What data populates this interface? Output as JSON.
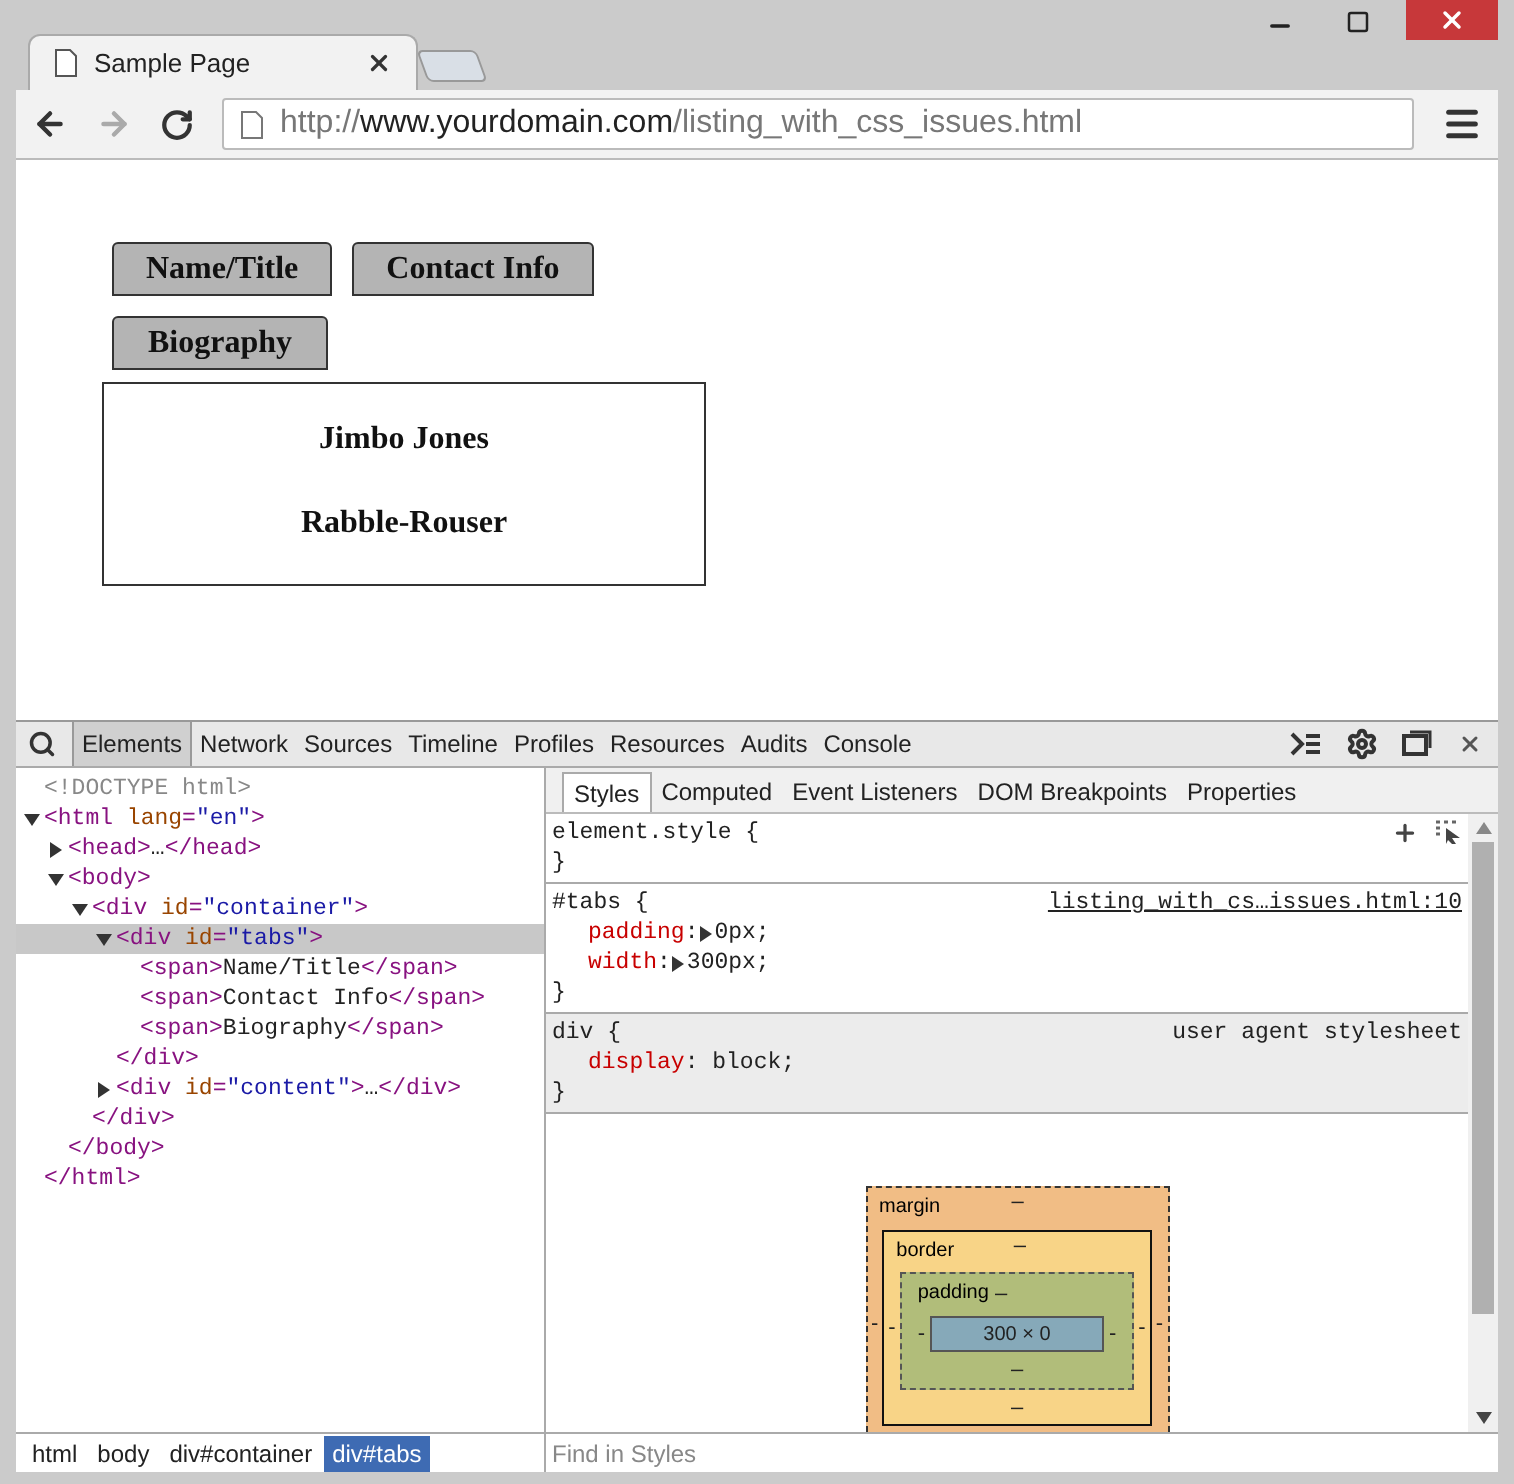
{
  "browser_tab": {
    "title": "Sample Page"
  },
  "address_bar": {
    "scheme": "http://",
    "host": "www.yourdomain.com",
    "path": "/listing_with_css_issues.html"
  },
  "page": {
    "tabs": [
      {
        "label": "Name/Title"
      },
      {
        "label": "Contact Info"
      },
      {
        "label": "Biography"
      }
    ],
    "content": [
      "Jimbo Jones",
      "Rabble-Rouser"
    ]
  },
  "devtools": {
    "panels": [
      {
        "label": "Elements",
        "selected": true
      },
      {
        "label": "Network",
        "selected": false
      },
      {
        "label": "Sources",
        "selected": false
      },
      {
        "label": "Timeline",
        "selected": false
      },
      {
        "label": "Profiles",
        "selected": false
      },
      {
        "label": "Resources",
        "selected": false
      },
      {
        "label": "Audits",
        "selected": false
      },
      {
        "label": "Console",
        "selected": false
      }
    ],
    "dom_tree": [
      {
        "tokens": [
          {
            "kind": "doctype",
            "text": "<!DOCTYPE html>"
          }
        ],
        "selected": false
      },
      {
        "tokens": [
          {
            "kind": "tag",
            "text": "<html "
          },
          {
            "kind": "attr",
            "text": "lang"
          },
          {
            "kind": "tag",
            "text": "="
          },
          {
            "kind": "value",
            "text": "\"en\""
          },
          {
            "kind": "tag",
            "text": ">"
          }
        ],
        "expanded": true,
        "selected": false,
        "children": [
          {
            "tokens": [
              {
                "kind": "tag",
                "text": "<head>"
              },
              {
                "kind": "text",
                "text": "…"
              },
              {
                "kind": "tag",
                "text": "</head>"
              }
            ],
            "expanded": false,
            "selected": false
          },
          {
            "tokens": [
              {
                "kind": "tag",
                "text": "<body>"
              }
            ],
            "expanded": true,
            "selected": false,
            "children": [
              {
                "tokens": [
                  {
                    "kind": "tag",
                    "text": "<div "
                  },
                  {
                    "kind": "attr",
                    "text": "id"
                  },
                  {
                    "kind": "tag",
                    "text": "="
                  },
                  {
                    "kind": "value",
                    "text": "\"container\""
                  },
                  {
                    "kind": "tag",
                    "text": ">"
                  }
                ],
                "expanded": true,
                "selected": false,
                "children": [
                  {
                    "tokens": [
                      {
                        "kind": "tag",
                        "text": "<div "
                      },
                      {
                        "kind": "attr",
                        "text": "id"
                      },
                      {
                        "kind": "tag",
                        "text": "="
                      },
                      {
                        "kind": "value",
                        "text": "\"tabs\""
                      },
                      {
                        "kind": "tag",
                        "text": ">"
                      }
                    ],
                    "expanded": true,
                    "selected": true,
                    "children": [
                      {
                        "tokens": [
                          {
                            "kind": "tag",
                            "text": "<span>"
                          },
                          {
                            "kind": "text",
                            "text": "Name/Title"
                          },
                          {
                            "kind": "tag",
                            "text": "</span>"
                          }
                        ],
                        "selected": false
                      },
                      {
                        "tokens": [
                          {
                            "kind": "tag",
                            "text": "<span>"
                          },
                          {
                            "kind": "text",
                            "text": "Contact Info"
                          },
                          {
                            "kind": "tag",
                            "text": "</span>"
                          }
                        ],
                        "selected": false
                      },
                      {
                        "tokens": [
                          {
                            "kind": "tag",
                            "text": "<span>"
                          },
                          {
                            "kind": "text",
                            "text": "Biography"
                          },
                          {
                            "kind": "tag",
                            "text": "</span>"
                          }
                        ],
                        "selected": false
                      }
                    ],
                    "close": "</div>"
                  },
                  {
                    "tokens": [
                      {
                        "kind": "tag",
                        "text": "<div "
                      },
                      {
                        "kind": "attr",
                        "text": "id"
                      },
                      {
                        "kind": "tag",
                        "text": "="
                      },
                      {
                        "kind": "value",
                        "text": "\"content\""
                      },
                      {
                        "kind": "tag",
                        "text": ">"
                      },
                      {
                        "kind": "text",
                        "text": "…"
                      },
                      {
                        "kind": "tag",
                        "text": "</div>"
                      }
                    ],
                    "expanded": false,
                    "selected": false
                  }
                ],
                "close": "</div>"
              }
            ],
            "close": "</body>"
          }
        ],
        "close": "</html>"
      }
    ],
    "breadcrumbs": [
      {
        "label": "html",
        "selected": false
      },
      {
        "label": "body",
        "selected": false
      },
      {
        "label": "div#container",
        "selected": false
      },
      {
        "label": "div#tabs",
        "selected": true
      }
    ],
    "sidebar_tabs": [
      {
        "label": "Styles",
        "selected": true
      },
      {
        "label": "Computed",
        "selected": false
      },
      {
        "label": "Event Listeners",
        "selected": false
      },
      {
        "label": "DOM Breakpoints",
        "selected": false
      },
      {
        "label": "Properties",
        "selected": false
      }
    ],
    "rules": [
      {
        "selector": "element.style {",
        "close": "}",
        "shaded": false,
        "tools": true
      },
      {
        "selector": "#tabs {",
        "source": "listing_with_cs…issues.html:10",
        "close": "}",
        "shaded": false,
        "tools": false,
        "properties": [
          {
            "name": "padding",
            "colon": ":",
            "value": "0px;",
            "expandable": true
          },
          {
            "name": "width",
            "colon": ":",
            "value": "300px;",
            "expandable": true
          }
        ]
      },
      {
        "selector": "div {",
        "origin": "user agent stylesheet",
        "close": "}",
        "shaded": true,
        "tools": false,
        "properties": [
          {
            "name": "display",
            "colon": ":",
            "value": " block;",
            "expandable": false
          }
        ]
      }
    ],
    "box_model": {
      "margin": {
        "label": "margin",
        "top": "–",
        "left": "-",
        "right": "-"
      },
      "border": {
        "label": "border",
        "top": "–",
        "left": "-",
        "right": "-",
        "bottom": "–"
      },
      "padding": {
        "label": "padding",
        "top": "–",
        "left": "-",
        "right": "-",
        "bottom": "–"
      },
      "content": "300 × 0"
    },
    "find_field": {
      "placeholder": "Find in Styles"
    }
  }
}
